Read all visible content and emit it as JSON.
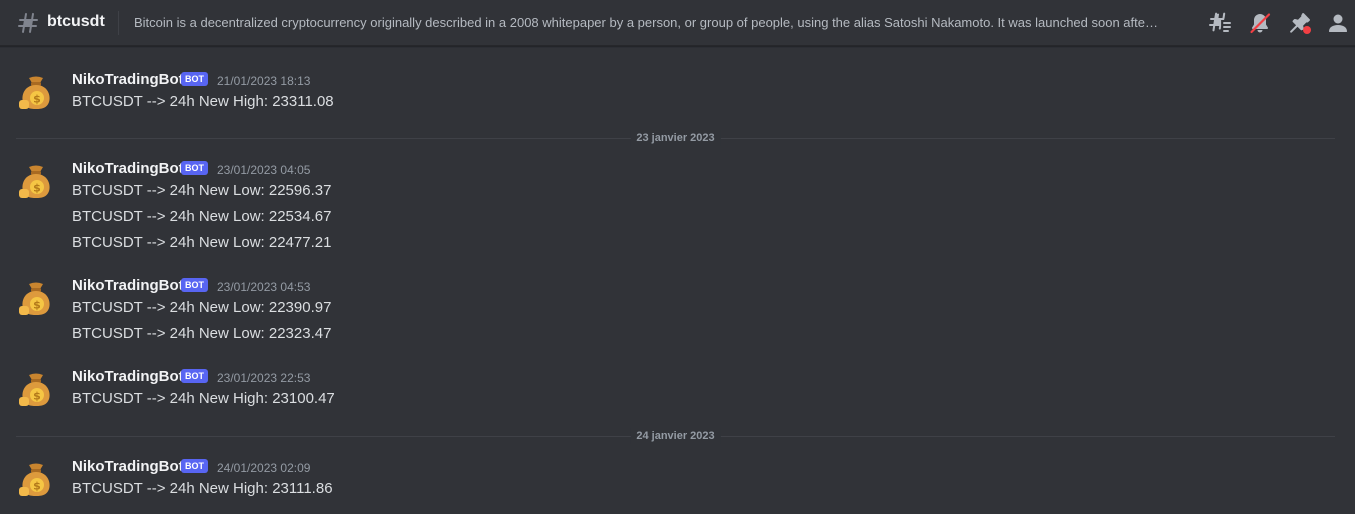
{
  "channel": {
    "name": "btcusdt",
    "topic": "Bitcoin is a decentralized cryptocurrency originally described in a 2008 whitepaper by a person, or group of people, using the alias Satoshi Nakamoto. It was launched soon afte…"
  },
  "toolbar": {
    "icons": [
      "threads-icon",
      "notifications-muted-icon",
      "pinned-messages-icon",
      "member-list-icon"
    ],
    "alert_color": "#f23f43"
  },
  "bot_badge": "BOT",
  "author": "NikoTradingBot",
  "separators": [
    "23 janvier 2023",
    "24 janvier 2023"
  ],
  "messages": [
    {
      "timestamp": "21/01/2023 18:13",
      "lines": [
        "BTCUSDT --> 24h New High: 23311.08"
      ]
    },
    {
      "timestamp": "23/01/2023 04:05",
      "lines": [
        "BTCUSDT --> 24h New Low: 22596.37",
        "BTCUSDT --> 24h New Low: 22534.67",
        "BTCUSDT --> 24h New Low: 22477.21"
      ]
    },
    {
      "timestamp": "23/01/2023 04:53",
      "lines": [
        "BTCUSDT --> 24h New Low: 22390.97",
        "BTCUSDT --> 24h New Low: 22323.47"
      ]
    },
    {
      "timestamp": "23/01/2023 22:53",
      "lines": [
        "BTCUSDT --> 24h New High: 23100.47"
      ]
    },
    {
      "timestamp": "24/01/2023 02:09",
      "lines": [
        "BTCUSDT --> 24h New High: 23111.86"
      ]
    }
  ]
}
